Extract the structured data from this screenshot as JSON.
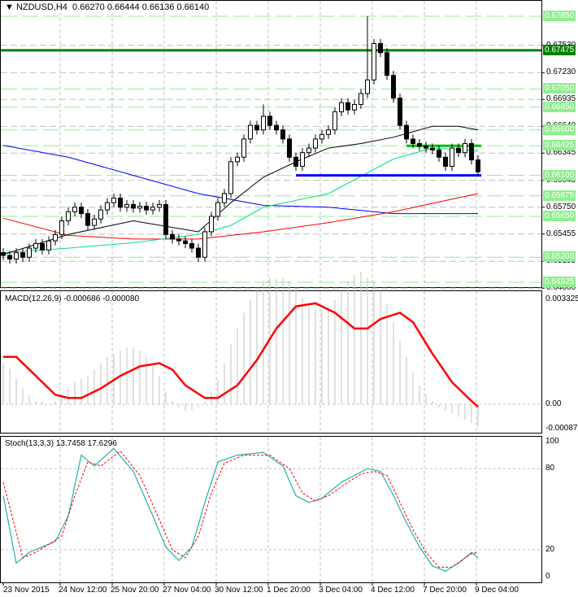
{
  "header": {
    "symbol": "NZDUSD,H4",
    "open": "0.66270",
    "high": "0.66444",
    "low": "0.66136",
    "close": "0.66140"
  },
  "price_axis": {
    "min": 0.64925,
    "max": 0.6785,
    "ticks": [
      "0.67530",
      "0.67230",
      "0.66935",
      "0.66640",
      "0.66345",
      "0.66045",
      "0.65750",
      "0.65455",
      "0.65155",
      "0.64860"
    ],
    "levels": [
      {
        "value": "0.67850",
        "kind": "light"
      },
      {
        "value": "0.67475",
        "kind": "dark"
      },
      {
        "value": "0.67050",
        "kind": "light"
      },
      {
        "value": "0.66850",
        "kind": "light"
      },
      {
        "value": "0.66600",
        "kind": "light"
      },
      {
        "value": "0.66425",
        "kind": "light"
      },
      {
        "value": "0.66100",
        "kind": "light"
      },
      {
        "value": "0.65875",
        "kind": "light"
      },
      {
        "value": "0.65650",
        "kind": "light"
      },
      {
        "value": "0.65200",
        "kind": "light"
      },
      {
        "value": "0.64925",
        "kind": "light"
      }
    ],
    "current": "0.66140"
  },
  "time_axis": [
    "23 Nov 2015",
    "24 Nov 12:00",
    "25 Nov 20:00",
    "27 Nov 04:00",
    "30 Nov 12:00",
    "1 Dec 20:00",
    "3 Dec 04:00",
    "4 Dec 12:00",
    "7 Dec 20:00",
    "9 Dec 04:00"
  ],
  "macd": {
    "label": "MACD(12,26,9) -0.000686 -0.000080",
    "max_label": "0.003325",
    "zero_label": "0.00",
    "min_label": "-0.000877"
  },
  "stoch": {
    "label": "Stoch(13,3,3) 13.7458 17.6296",
    "levels": [
      "100",
      "80",
      "20",
      "0"
    ]
  },
  "colors": {
    "bull": "#ffffff",
    "bear": "#000000",
    "resistance": "#008000",
    "support": "#0000ff",
    "signal": "#ff0000",
    "stoch_main": "#20b2aa",
    "level_light": "#90ee90"
  },
  "chart_data": {
    "type": "candlestick",
    "closes": [
      0.6522,
      0.6518,
      0.6525,
      0.652,
      0.653,
      0.6535,
      0.6528,
      0.6538,
      0.6545,
      0.656,
      0.657,
      0.6575,
      0.6568,
      0.6555,
      0.6562,
      0.6572,
      0.658,
      0.6585,
      0.6575,
      0.6578,
      0.6574,
      0.6576,
      0.6572,
      0.6575,
      0.6578,
      0.6545,
      0.654,
      0.6538,
      0.6535,
      0.653,
      0.652,
      0.6548,
      0.6565,
      0.658,
      0.659,
      0.6625,
      0.663,
      0.665,
      0.6665,
      0.666,
      0.6675,
      0.6665,
      0.666,
      0.665,
      0.663,
      0.662,
      0.6635,
      0.664,
      0.665,
      0.6655,
      0.666,
      0.668,
      0.669,
      0.6682,
      0.6688,
      0.67,
      0.6715,
      0.6755,
      0.6745,
      0.672,
      0.6695,
      0.6665,
      0.665,
      0.6645,
      0.6642,
      0.664,
      0.6638,
      0.663,
      0.662,
      0.664,
      0.6635,
      0.6645,
      0.6627,
      0.6614
    ],
    "high_overrides": [
      {
        "i": 56,
        "high": 0.6785
      },
      {
        "i": 40,
        "high": 0.6688
      }
    ],
    "resistance_level": 0.67475,
    "support_level": 0.661,
    "support_segment": [
      45,
      73
    ],
    "range_level": 0.66425,
    "range_segment": [
      62,
      73
    ],
    "ma_black": [
      [
        0,
        0.6523
      ],
      [
        10,
        0.6545
      ],
      [
        20,
        0.656
      ],
      [
        30,
        0.6548
      ],
      [
        35,
        0.658
      ],
      [
        40,
        0.6608
      ],
      [
        45,
        0.6625
      ],
      [
        50,
        0.664
      ],
      [
        55,
        0.6645
      ],
      [
        60,
        0.6652
      ],
      [
        66,
        0.6664
      ],
      [
        70,
        0.6664
      ],
      [
        73,
        0.666
      ]
    ],
    "ma_cyan": [
      [
        0,
        0.6525
      ],
      [
        10,
        0.653
      ],
      [
        20,
        0.6536
      ],
      [
        30,
        0.6545
      ],
      [
        35,
        0.6555
      ],
      [
        40,
        0.6575
      ],
      [
        50,
        0.659
      ],
      [
        60,
        0.6628
      ],
      [
        66,
        0.664
      ],
      [
        73,
        0.6637
      ]
    ],
    "ma_red": [
      [
        0,
        0.6563
      ],
      [
        10,
        0.6544
      ],
      [
        20,
        0.654
      ],
      [
        30,
        0.654
      ],
      [
        40,
        0.6548
      ],
      [
        50,
        0.6558
      ],
      [
        60,
        0.657
      ],
      [
        73,
        0.659
      ]
    ],
    "ma_blue": [
      [
        0,
        0.6643
      ],
      [
        10,
        0.663
      ],
      [
        20,
        0.661
      ],
      [
        30,
        0.659
      ],
      [
        40,
        0.6577
      ],
      [
        50,
        0.6575
      ],
      [
        60,
        0.6568
      ],
      [
        73,
        0.6568
      ]
    ],
    "macd_range": [
      -0.000877,
      0.003325
    ],
    "macd_hist": [
      0.0013,
      0.0011,
      0.0008,
      0.0005,
      0.0003,
      0.0001,
      0.0001,
      0.0,
      0.0001,
      0.0003,
      0.0005,
      0.0007,
      0.0008,
      0.0009,
      0.0011,
      0.0013,
      0.0015,
      0.0016,
      0.0017,
      0.0018,
      0.0018,
      0.0017,
      0.0015,
      0.0012,
      0.0009,
      0.0004,
      0.0001,
      -0.0001,
      -0.0002,
      -0.0002,
      -0.0001,
      0.0001,
      0.0004,
      0.0008,
      0.0013,
      0.0019,
      0.0024,
      0.0029,
      0.0033,
      0.0036,
      0.0039,
      0.004,
      0.004,
      0.004,
      0.0039,
      0.0037,
      0.0034,
      0.0031,
      0.003,
      0.003,
      0.0031,
      0.0033,
      0.0036,
      0.0039,
      0.0041,
      0.0042,
      0.004,
      0.0039,
      0.0036,
      0.0032,
      0.0026,
      0.002,
      0.0015,
      0.001,
      0.0006,
      0.0003,
      0.0001,
      -0.0001,
      -0.0002,
      -0.0003,
      -0.0004,
      -0.0005,
      -0.0006,
      -0.0007
    ],
    "macd_signal": [
      [
        0,
        0.0015
      ],
      [
        2,
        0.0015
      ],
      [
        5,
        0.0009
      ],
      [
        8,
        0.0003
      ],
      [
        10,
        0.0002
      ],
      [
        12,
        0.0002
      ],
      [
        15,
        0.0005
      ],
      [
        18,
        0.0009
      ],
      [
        21,
        0.0012
      ],
      [
        24,
        0.0013
      ],
      [
        26,
        0.0011
      ],
      [
        28,
        0.0006
      ],
      [
        31,
        0.0002
      ],
      [
        33,
        0.0002
      ],
      [
        36,
        0.0006
      ],
      [
        39,
        0.0014
      ],
      [
        42,
        0.0024
      ],
      [
        45,
        0.0031
      ],
      [
        48,
        0.0032
      ],
      [
        51,
        0.0029
      ],
      [
        54,
        0.0024
      ],
      [
        56,
        0.0024
      ],
      [
        58,
        0.0027
      ],
      [
        61,
        0.0029
      ],
      [
        63,
        0.0026
      ],
      [
        66,
        0.0016
      ],
      [
        69,
        0.0007
      ],
      [
        72,
        0.0001
      ],
      [
        73,
        -8e-05
      ]
    ],
    "stoch_main": [
      [
        0,
        60
      ],
      [
        2,
        10
      ],
      [
        4,
        18
      ],
      [
        6,
        22
      ],
      [
        8,
        26
      ],
      [
        10,
        45
      ],
      [
        12,
        90
      ],
      [
        14,
        82
      ],
      [
        17,
        95
      ],
      [
        20,
        78
      ],
      [
        23,
        45
      ],
      [
        25,
        22
      ],
      [
        27,
        12
      ],
      [
        29,
        22
      ],
      [
        31,
        55
      ],
      [
        33,
        85
      ],
      [
        36,
        90
      ],
      [
        40,
        92
      ],
      [
        43,
        82
      ],
      [
        45,
        60
      ],
      [
        47,
        55
      ],
      [
        49,
        58
      ],
      [
        52,
        70
      ],
      [
        54,
        75
      ],
      [
        56,
        80
      ],
      [
        58,
        78
      ],
      [
        60,
        60
      ],
      [
        62,
        40
      ],
      [
        64,
        22
      ],
      [
        66,
        8
      ],
      [
        68,
        4
      ],
      [
        70,
        10
      ],
      [
        72,
        18
      ],
      [
        73,
        14
      ]
    ],
    "stoch_signal": [
      [
        0,
        70
      ],
      [
        3,
        14
      ],
      [
        5,
        18
      ],
      [
        7,
        24
      ],
      [
        9,
        30
      ],
      [
        11,
        60
      ],
      [
        13,
        85
      ],
      [
        15,
        82
      ],
      [
        18,
        93
      ],
      [
        21,
        75
      ],
      [
        24,
        42
      ],
      [
        26,
        20
      ],
      [
        28,
        14
      ],
      [
        30,
        30
      ],
      [
        32,
        62
      ],
      [
        34,
        84
      ],
      [
        37,
        90
      ],
      [
        41,
        90
      ],
      [
        44,
        80
      ],
      [
        46,
        62
      ],
      [
        48,
        56
      ],
      [
        50,
        60
      ],
      [
        53,
        70
      ],
      [
        55,
        76
      ],
      [
        57,
        78
      ],
      [
        59,
        75
      ],
      [
        61,
        55
      ],
      [
        63,
        35
      ],
      [
        65,
        18
      ],
      [
        67,
        7
      ],
      [
        69,
        7
      ],
      [
        71,
        14
      ],
      [
        72,
        17
      ],
      [
        73,
        18
      ]
    ]
  }
}
